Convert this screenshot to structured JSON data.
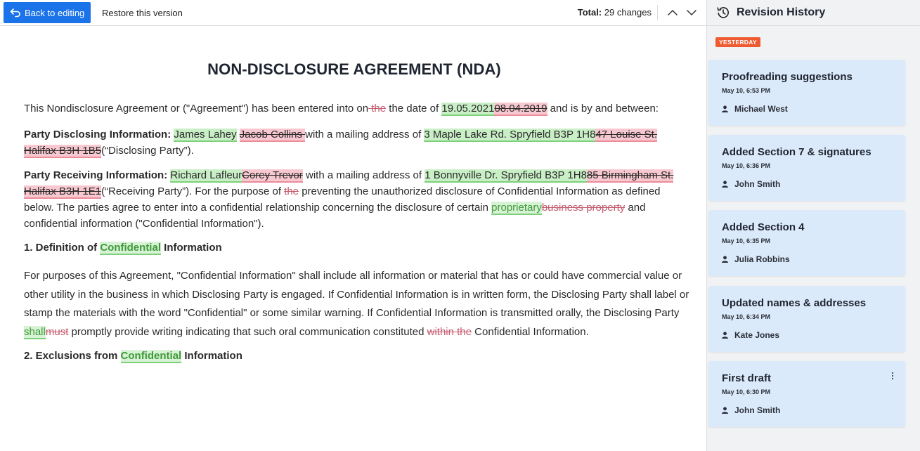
{
  "toolbar": {
    "back_label": "Back to editing",
    "restore_label": "Restore this version",
    "total_label": "Total:",
    "total_value": "29 changes"
  },
  "document": {
    "title": "NON-DISCLOSURE AGREEMENT (NDA)",
    "intro": {
      "t1": "This Nondisclosure Agreement or (\"Agreement\") has been entered into on",
      "del1": " the",
      "t2": " the date of ",
      "ins1": "19.05.2021",
      "del2": "08.04.2019",
      "t3": " and is by and between:"
    },
    "disclosing": {
      "label": "Party Disclosing Information:",
      "ins_name": "James Lahey",
      "del_name": "Jacob Collins ",
      "t1": "with a mailing address of ",
      "ins_addr": "3 Maple Lake Rd. Spryfield B3P 1H8",
      "del_addr": "47 Louise St. Halifax B3H 1B5",
      "t2": "(“Disclosing Party”)."
    },
    "receiving": {
      "label": "Party Receiving Information:",
      "ins_name": "Richard Lafleur",
      "del_name": "Corey Trevor",
      "t1": " with a mailing address of ",
      "ins_addr": "1 Bonnyville Dr. Spryfield B3P 1H8",
      "del_addr": "85 Birmingham St. Halifax B3H 1E1",
      "t2": "(“Receiving Party”). For the purpose of ",
      "del1": "the",
      "t3": " preventing the unauthorized disclosure of Confidential Information as defined below. The parties agree to enter into a confidential relationship concerning the disclosure of certain ",
      "ins1": "proprietary",
      "del2": "business property",
      "t4": " and confidential information (\"Confidential Information\")."
    },
    "section1": {
      "heading_pre": "1. Definition of ",
      "heading_ins": "Confidential",
      "heading_post": " Information",
      "t1": "For purposes of this Agreement, \"Confidential Information\" shall include all information or material that has or could have commercial value or other utility in the business in which Disclosing Party is engaged. If Confidential Information is in written form, the Disclosing Party shall label or stamp the materials with the word \"Confidential\" or some similar warning. If Confidential Information is transmitted orally, the Disclosing Party ",
      "ins1": "shall",
      "del1": "must",
      "t2": " promptly provide writing indicating that such oral communication constituted ",
      "del2": "within the",
      "t3": " Confidential Information."
    },
    "section2": {
      "heading_pre": "2. Exclusions from ",
      "heading_ins": "Confidential",
      "heading_post": " Information"
    }
  },
  "panel": {
    "title": "Revision History",
    "day_label": "YESTERDAY",
    "revisions": [
      {
        "title": "Proofreading suggestions",
        "date": "May 10, 6:53 PM",
        "user": "Michael West"
      },
      {
        "title": "Added Section 7 & signatures",
        "date": "May 10, 6:36 PM",
        "user": "John Smith"
      },
      {
        "title": "Added Section 4",
        "date": "May 10, 6:35 PM",
        "user": "Julia Robbins"
      },
      {
        "title": "Updated names & addresses",
        "date": "May 10, 6:34 PM",
        "user": "Kate Jones"
      },
      {
        "title": "First draft",
        "date": "May 10, 6:30 PM",
        "user": "John Smith"
      }
    ]
  },
  "colors": {
    "accent": "#1a73e8",
    "insert_bg": "#c9efc6",
    "delete_bg": "#f7c8cf",
    "badge": "#f05a30",
    "card_bg": "#dbeafa"
  },
  "icons": [
    "back-arrow-icon",
    "chevron-up-icon",
    "chevron-down-icon",
    "history-icon",
    "user-icon",
    "more-vertical-icon"
  ]
}
